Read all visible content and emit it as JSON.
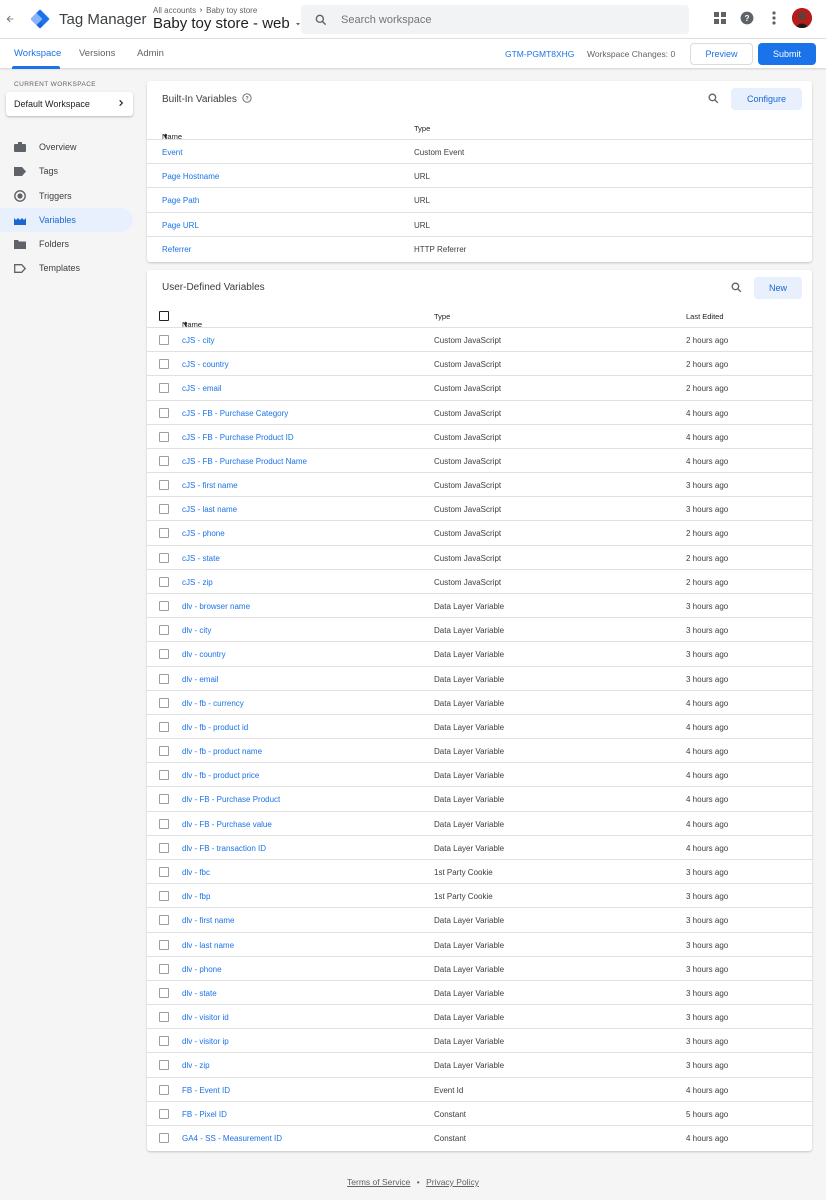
{
  "app": {
    "title": "Tag Manager",
    "breadcrumb": [
      "All accounts",
      "Baby toy store"
    ],
    "container": "Baby toy store - web",
    "search_placeholder": "Search workspace",
    "brand_color": "#1a73e8"
  },
  "subnav": {
    "tabs": [
      "Workspace",
      "Versions",
      "Admin"
    ],
    "container_id": "GTM-PGMT8XHG",
    "workspace_changes": "Workspace Changes: 0",
    "preview_label": "Preview",
    "submit_label": "Submit"
  },
  "sidebar": {
    "current_workspace_label": "CURRENT WORKSPACE",
    "workspace_name": "Default Workspace",
    "items": [
      {
        "label": "Overview",
        "icon": "briefcase-icon"
      },
      {
        "label": "Tags",
        "icon": "tag-icon"
      },
      {
        "label": "Triggers",
        "icon": "trigger-icon"
      },
      {
        "label": "Variables",
        "icon": "variables-icon"
      },
      {
        "label": "Folders",
        "icon": "folder-icon"
      },
      {
        "label": "Templates",
        "icon": "template-icon"
      }
    ]
  },
  "builtin": {
    "title": "Built-In Variables",
    "configure_label": "Configure",
    "col_name": "Name",
    "col_type": "Type",
    "rows": [
      {
        "name": "Event",
        "type": "Custom Event"
      },
      {
        "name": "Page Hostname",
        "type": "URL"
      },
      {
        "name": "Page Path",
        "type": "URL"
      },
      {
        "name": "Page URL",
        "type": "URL"
      },
      {
        "name": "Referrer",
        "type": "HTTP Referrer"
      }
    ]
  },
  "userdefined": {
    "title": "User-Defined Variables",
    "new_label": "New",
    "col_name": "Name",
    "col_type": "Type",
    "col_edited": "Last Edited",
    "rows": [
      {
        "name": "cJS - city",
        "type": "Custom JavaScript",
        "edited": "2 hours ago"
      },
      {
        "name": "cJS - country",
        "type": "Custom JavaScript",
        "edited": "2 hours ago"
      },
      {
        "name": "cJS - email",
        "type": "Custom JavaScript",
        "edited": "2 hours ago"
      },
      {
        "name": "cJS - FB - Purchase Category",
        "type": "Custom JavaScript",
        "edited": "4 hours ago"
      },
      {
        "name": "cJS - FB - Purchase Product ID",
        "type": "Custom JavaScript",
        "edited": "4 hours ago"
      },
      {
        "name": "cJS - FB - Purchase Product Name",
        "type": "Custom JavaScript",
        "edited": "4 hours ago"
      },
      {
        "name": "cJS - first name",
        "type": "Custom JavaScript",
        "edited": "3 hours ago"
      },
      {
        "name": "cJS - last name",
        "type": "Custom JavaScript",
        "edited": "3 hours ago"
      },
      {
        "name": "cJS - phone",
        "type": "Custom JavaScript",
        "edited": "2 hours ago"
      },
      {
        "name": "cJS - state",
        "type": "Custom JavaScript",
        "edited": "2 hours ago"
      },
      {
        "name": "cJS - zip",
        "type": "Custom JavaScript",
        "edited": "2 hours ago"
      },
      {
        "name": "dlv - browser name",
        "type": "Data Layer Variable",
        "edited": "3 hours ago"
      },
      {
        "name": "dlv - city",
        "type": "Data Layer Variable",
        "edited": "3 hours ago"
      },
      {
        "name": "dlv - country",
        "type": "Data Layer Variable",
        "edited": "3 hours ago"
      },
      {
        "name": "dlv - email",
        "type": "Data Layer Variable",
        "edited": "3 hours ago"
      },
      {
        "name": "dlv - fb - currency",
        "type": "Data Layer Variable",
        "edited": "4 hours ago"
      },
      {
        "name": "dlv - fb - product id",
        "type": "Data Layer Variable",
        "edited": "4 hours ago"
      },
      {
        "name": "dlv - fb - product name",
        "type": "Data Layer Variable",
        "edited": "4 hours ago"
      },
      {
        "name": "dlv - fb - product price",
        "type": "Data Layer Variable",
        "edited": "4 hours ago"
      },
      {
        "name": "dlv - FB - Purchase Product",
        "type": "Data Layer Variable",
        "edited": "4 hours ago"
      },
      {
        "name": "dlv - FB - Purchase value",
        "type": "Data Layer Variable",
        "edited": "4 hours ago"
      },
      {
        "name": "dlv - FB - transaction ID",
        "type": "Data Layer Variable",
        "edited": "4 hours ago"
      },
      {
        "name": "dlv - fbc",
        "type": "1st Party Cookie",
        "edited": "3 hours ago"
      },
      {
        "name": "dlv - fbp",
        "type": "1st Party Cookie",
        "edited": "3 hours ago"
      },
      {
        "name": "dlv - first name",
        "type": "Data Layer Variable",
        "edited": "3 hours ago"
      },
      {
        "name": "dlv - last name",
        "type": "Data Layer Variable",
        "edited": "3 hours ago"
      },
      {
        "name": "dlv - phone",
        "type": "Data Layer Variable",
        "edited": "3 hours ago"
      },
      {
        "name": "dlv - state",
        "type": "Data Layer Variable",
        "edited": "3 hours ago"
      },
      {
        "name": "dlv - visitor id",
        "type": "Data Layer Variable",
        "edited": "3 hours ago"
      },
      {
        "name": "dlv - visitor ip",
        "type": "Data Layer Variable",
        "edited": "3 hours ago"
      },
      {
        "name": "dlv - zip",
        "type": "Data Layer Variable",
        "edited": "3 hours ago"
      },
      {
        "name": "FB - Event ID",
        "type": "Event Id",
        "edited": "4 hours ago"
      },
      {
        "name": "FB - Pixel ID",
        "type": "Constant",
        "edited": "5 hours ago"
      },
      {
        "name": "GA4 - SS - Measurement ID",
        "type": "Constant",
        "edited": "4 hours ago"
      }
    ]
  },
  "footer": {
    "terms": "Terms of Service",
    "separator": "•",
    "privacy": "Privacy Policy"
  }
}
